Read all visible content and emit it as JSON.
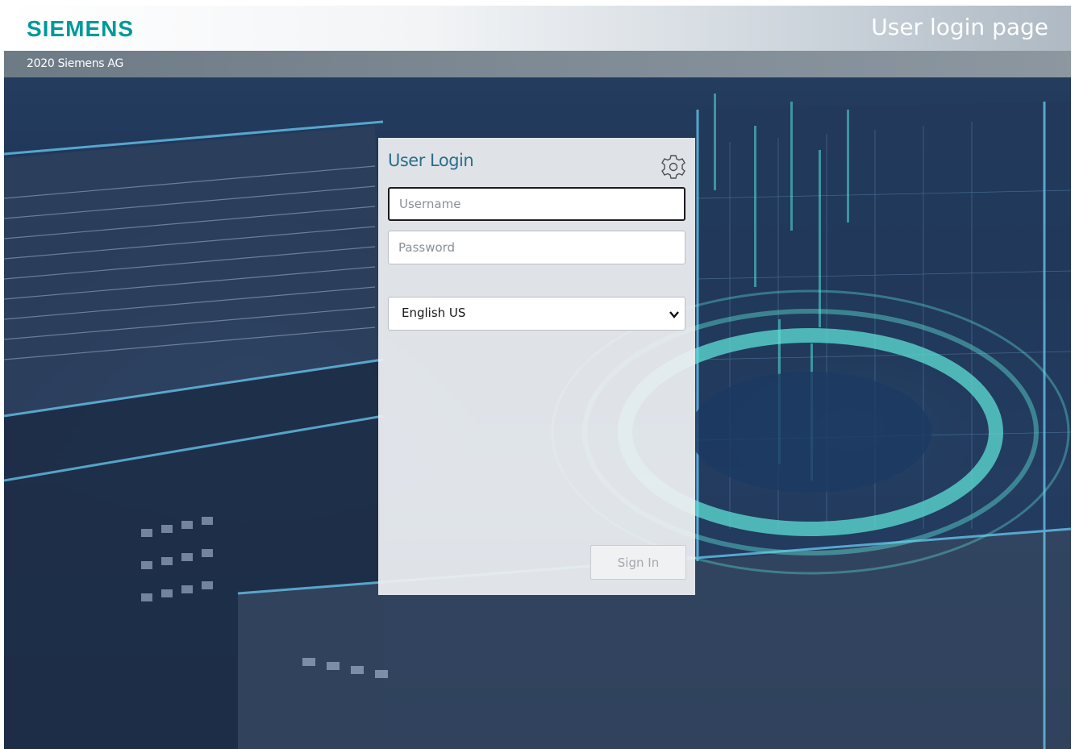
{
  "header": {
    "logo_text": "SIEMENS",
    "page_title": "User login page",
    "copyright": "2020 Siemens AG",
    "brand_color": "#009999"
  },
  "login": {
    "title": "User Login",
    "username_placeholder": "Username",
    "password_placeholder": "Password",
    "language_selected": "English US",
    "signin_label": "Sign In",
    "settings_icon": "gear-icon"
  }
}
